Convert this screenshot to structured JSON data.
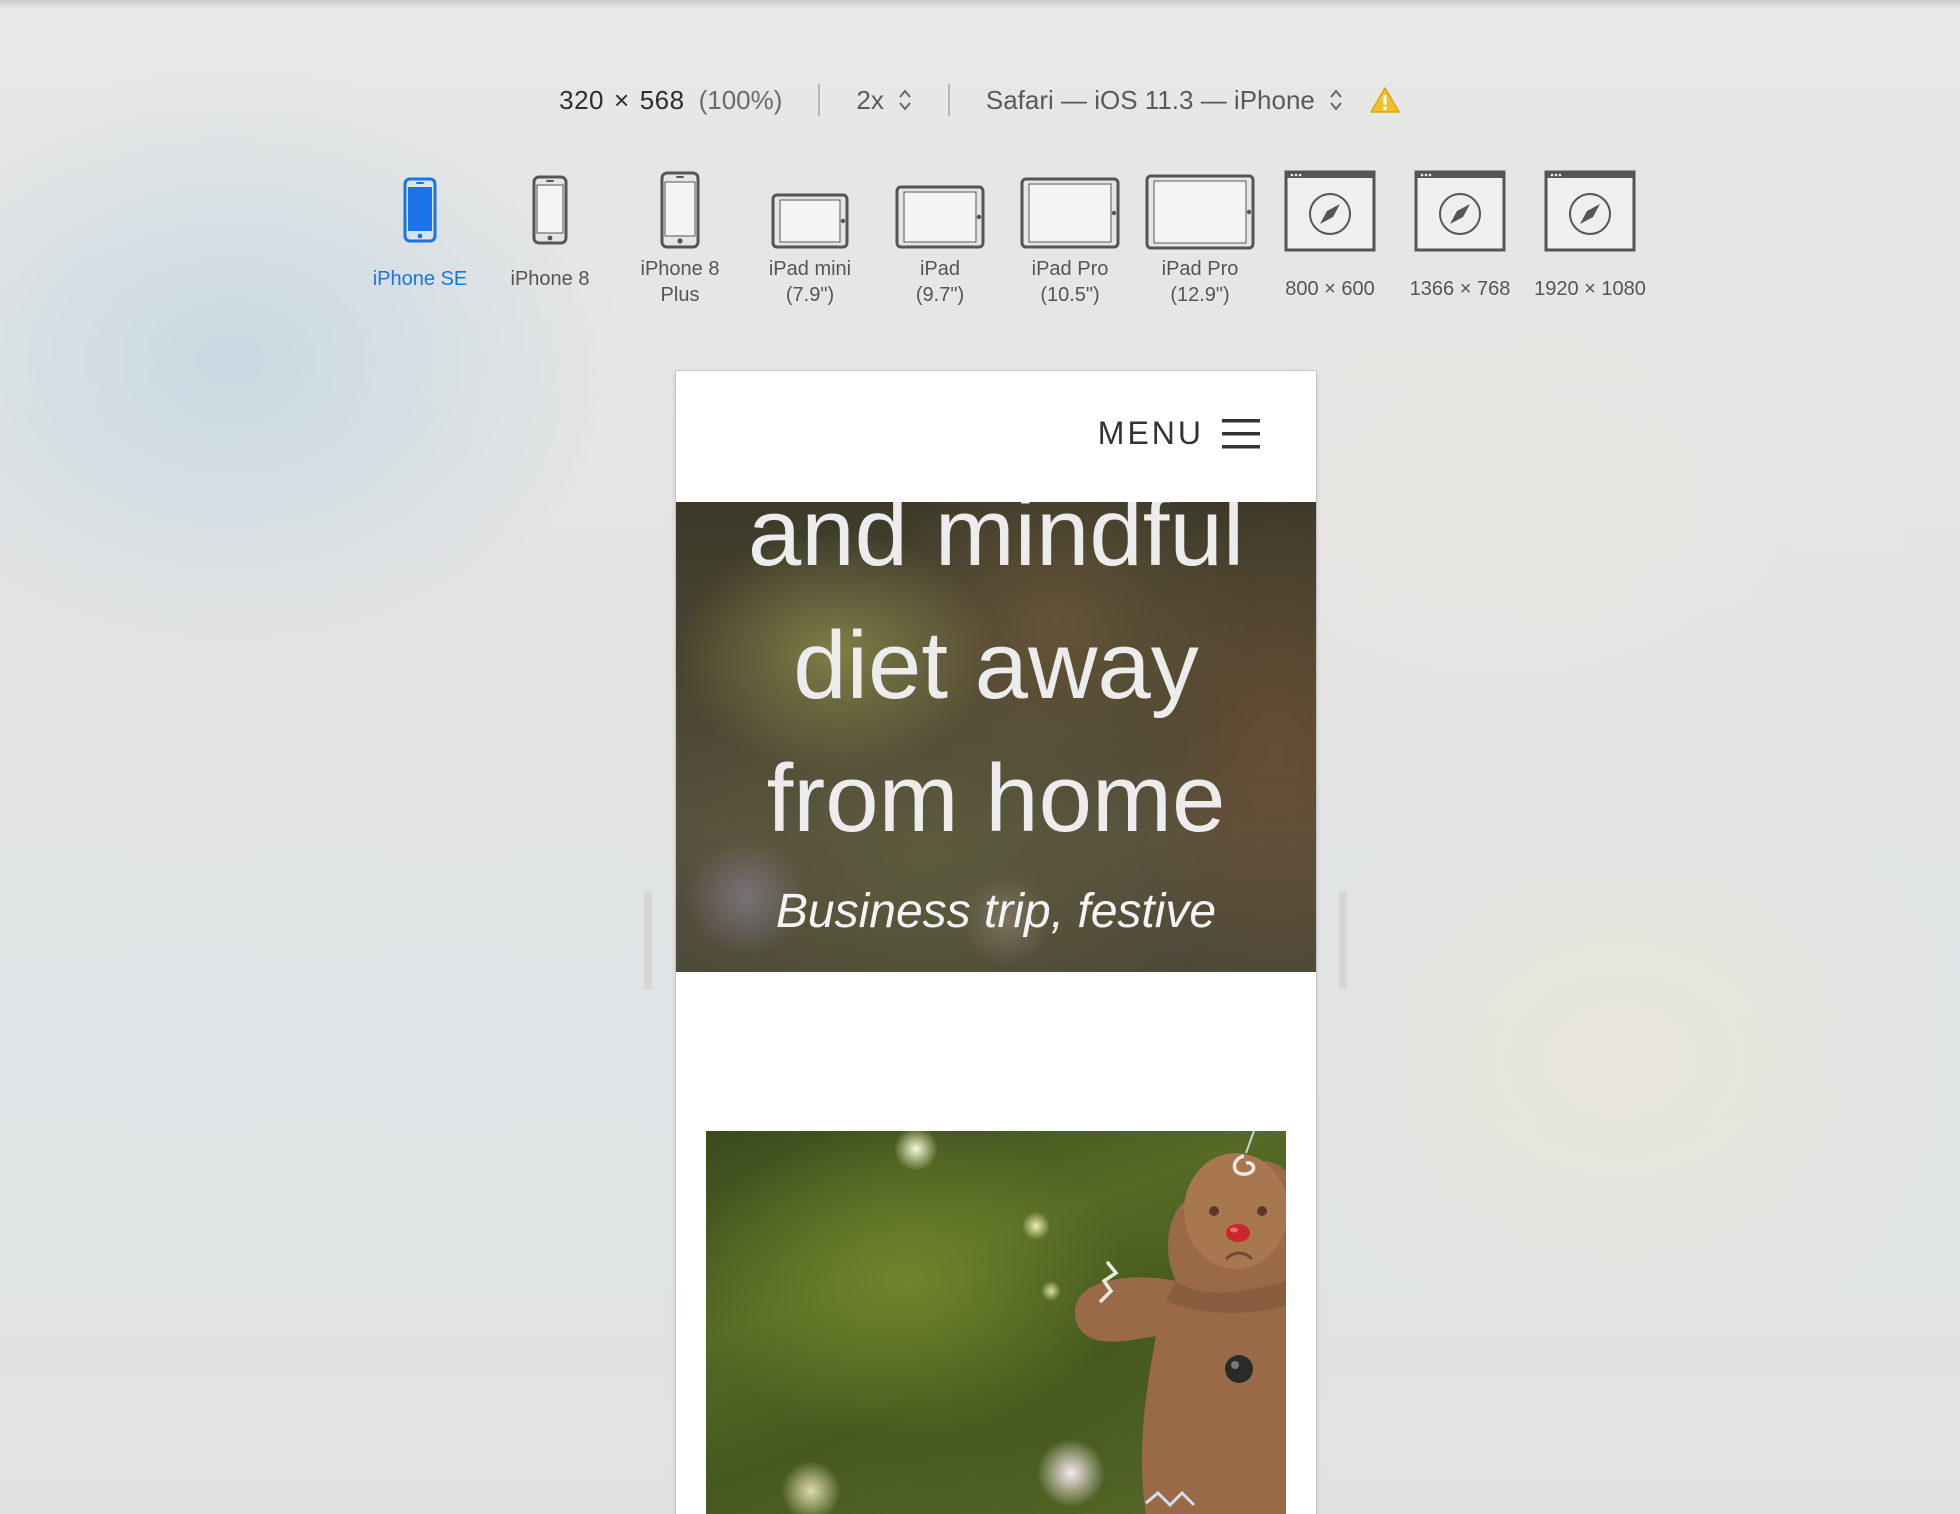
{
  "toolbar": {
    "width": "320",
    "times": "×",
    "height": "568",
    "zoom": "(100%)",
    "scale": "2x",
    "browser": "Safari — iOS 11.3 — iPhone",
    "stepper_icon": "chevron-up-down-icon",
    "warning_icon": "warning-triangle-icon"
  },
  "devices": [
    {
      "label": "iPhone SE",
      "icon": "phone-icon",
      "selected": true
    },
    {
      "label": "iPhone 8",
      "icon": "phone-icon",
      "selected": false
    },
    {
      "label": "iPhone 8\nPlus",
      "icon": "phone-icon",
      "selected": false
    },
    {
      "label": "iPad mini\n(7.9\")",
      "icon": "tablet-icon",
      "selected": false
    },
    {
      "label": "iPad\n(9.7\")",
      "icon": "tablet-icon",
      "selected": false
    },
    {
      "label": "iPad Pro\n(10.5\")",
      "icon": "tablet-icon",
      "selected": false
    },
    {
      "label": "iPad Pro\n(12.9\")",
      "icon": "tablet-icon",
      "selected": false
    },
    {
      "label": "800 × 600",
      "icon": "browser-window-icon",
      "selected": false
    },
    {
      "label": "1366 × 768",
      "icon": "browser-window-icon",
      "selected": false
    },
    {
      "label": "1920 × 1080",
      "icon": "browser-window-icon",
      "selected": false
    }
  ],
  "site": {
    "menu_label": "MENU",
    "menu_icon": "hamburger-icon",
    "hero_title_line1": "and mindful",
    "hero_title_line2": "diet away",
    "hero_title_line3": "from home",
    "hero_subtitle": "Business trip, festive"
  },
  "colors": {
    "selected_accent": "#1a74e8",
    "warning": "#f2c12e"
  }
}
